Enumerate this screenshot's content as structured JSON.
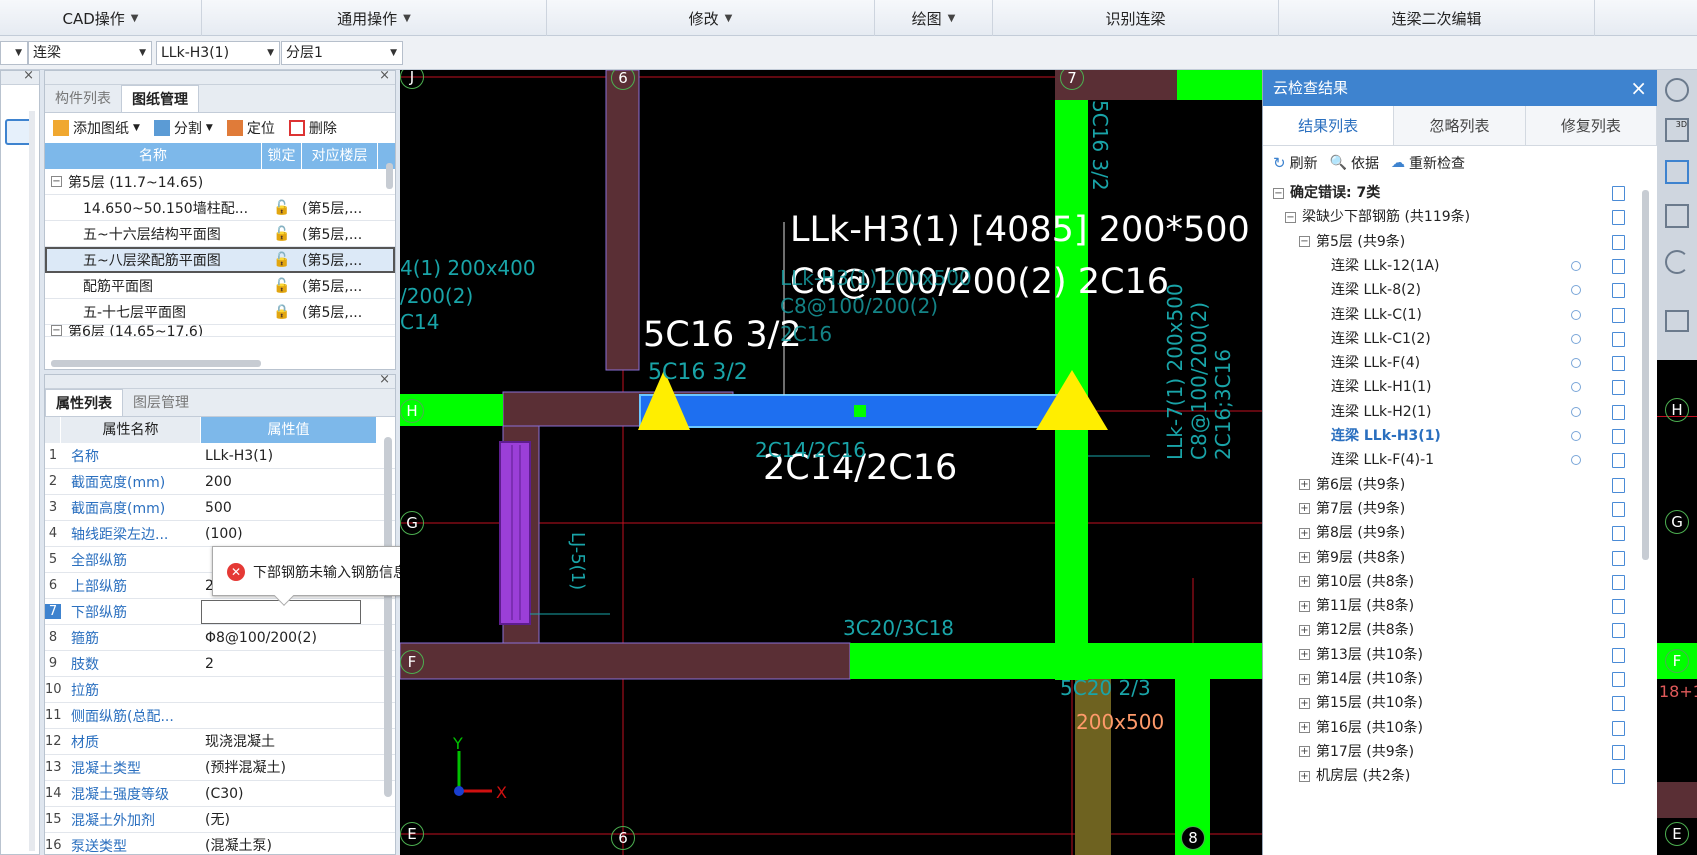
{
  "ribbon": {
    "groups": [
      {
        "label": "CAD操作",
        "dropdown": true
      },
      {
        "label": "通用操作",
        "dropdown": true
      },
      {
        "label": "修改",
        "dropdown": true
      },
      {
        "label": "绘图",
        "dropdown": true
      },
      {
        "label": "识别连梁",
        "dropdown": false
      },
      {
        "label": "连梁二次编辑",
        "dropdown": false
      }
    ]
  },
  "selectors": {
    "type": "连梁",
    "name": "LLk-H3(1)",
    "layer": "分层1"
  },
  "drawing_panel": {
    "tabs": [
      "构件列表",
      "图纸管理"
    ],
    "active_tab": "图纸管理",
    "toolbar": {
      "add": "添加图纸",
      "split": "分割",
      "locate": "定位",
      "delete": "删除"
    },
    "columns": [
      "名称",
      "锁定",
      "对应楼层"
    ],
    "floor_group": "第5层 (11.7~14.65)",
    "rows": [
      {
        "name": "14.650~50.150墙柱配...",
        "floor": "(第5层,..."
      },
      {
        "name": "五~十六层结构平面图",
        "floor": "(第5层,..."
      },
      {
        "name": "五~八层梁配筋平面图",
        "floor": "(第5层,..."
      },
      {
        "name": "配筋平面图",
        "floor": "(第5层,..."
      },
      {
        "name": "五-十七层平面图",
        "floor": "(第5层,..."
      }
    ],
    "next_group": "第6层 (14.65~17.6)"
  },
  "property_panel": {
    "tabs": [
      "属性列表",
      "图层管理"
    ],
    "active_tab": "属性列表",
    "columns": [
      "属性名称",
      "属性值"
    ],
    "rows": [
      {
        "n": "1",
        "name": "名称",
        "value": "LLk-H3(1)"
      },
      {
        "n": "2",
        "name": "截面宽度(mm)",
        "value": "200"
      },
      {
        "n": "3",
        "name": "截面高度(mm)",
        "value": "500"
      },
      {
        "n": "4",
        "name": "轴线距梁左边...",
        "value": "(100)"
      },
      {
        "n": "5",
        "name": "全部纵筋",
        "value": ""
      },
      {
        "n": "6",
        "name": "上部纵筋",
        "value": "2"
      },
      {
        "n": "7",
        "name": "下部纵筋",
        "value": ""
      },
      {
        "n": "8",
        "name": "箍筋",
        "value": "Φ8@100/200(2)"
      },
      {
        "n": "9",
        "name": "肢数",
        "value": "2"
      },
      {
        "n": "10",
        "name": "拉筋",
        "value": ""
      },
      {
        "n": "11",
        "name": "侧面纵筋(总配...",
        "value": ""
      },
      {
        "n": "12",
        "name": "材质",
        "value": "现浇混凝土"
      },
      {
        "n": "13",
        "name": "混凝土类型",
        "value": "(预拌混凝土)"
      },
      {
        "n": "14",
        "name": "混凝土强度等级",
        "value": "(C30)"
      },
      {
        "n": "15",
        "name": "混凝土外加剂",
        "value": "(无)"
      },
      {
        "n": "16",
        "name": "泵送类型",
        "value": "(混凝土泵)"
      }
    ],
    "popup": "下部钢筋未输入钢筋信息"
  },
  "canvas": {
    "axis_labels": {
      "J": "J",
      "H": "H",
      "G": "G",
      "F": "F",
      "E": "E",
      "c6": "6",
      "c7": "7",
      "c8": "8"
    },
    "annotations": {
      "main1": "LLk-H3(1) [4085] 200*500",
      "main2": "C8@100/200(2) 2C16",
      "top_left_bar": "5C16 3/2",
      "small_top": "5C16 3/2",
      "bottom_bar": "2C14/2C16",
      "small_bottom": "2C14/2C16",
      "left1": "4(1) 200x400",
      "left2": "/200(2)",
      "left3": "C14",
      "vert_right": "5C16 3/2",
      "vert_beam": "LLk-7(1) 200x500",
      "vert_beam2": "C8@100/200(2)",
      "vert_beam3": "2C16;3C16",
      "ghost1": "LLk-H3(1) 200x500",
      "ghost2": "C8@100/200(2)",
      "ghost3": "2C16",
      "lj": "LJ-5(1)",
      "bar_f": "3C20/3C18",
      "bar_e1": "5C20 2/3",
      "bar_e2": "200x500",
      "y_axis": "Y",
      "x_axis": "X",
      "edge": "18+1"
    }
  },
  "result_panel": {
    "title": "云检查结果",
    "tabs": [
      "结果列表",
      "忽略列表",
      "修复列表"
    ],
    "active_tab": "结果列表",
    "tools": {
      "refresh": "刷新",
      "basis": "依据",
      "recheck": "重新检查"
    },
    "root": "确定错误: 7类",
    "category": "梁缺少下部钢筋 (共119条)",
    "floor5": "第5层 (共9条)",
    "items": [
      "连梁 LLk-12(1A)",
      "连梁 LLk-8(2)",
      "连梁 LLk-C(1)",
      "连梁 LLk-C1(2)",
      "连梁 LLk-F(4)",
      "连梁 LLk-H1(1)",
      "连梁 LLk-H2(1)",
      "连梁 LLk-H3(1)",
      "连梁 LLk-F(4)-1"
    ],
    "selected_item": "连梁 LLk-H3(1)",
    "other_floors": [
      "第6层 (共9条)",
      "第7层 (共9条)",
      "第8层 (共9条)",
      "第9层 (共8条)",
      "第10层 (共8条)",
      "第11层 (共8条)",
      "第12层 (共8条)",
      "第13层 (共10条)",
      "第14层 (共10条)",
      "第15层 (共10条)",
      "第16层 (共10条)",
      "第17层 (共9条)",
      "机房层 (共2条)"
    ]
  },
  "colors": {
    "accent": "#3e83cf",
    "beam_blue": "#1e6ff0",
    "wall_green": "#00ff00",
    "column_maroon": "#5a2f35",
    "grid_red": "#d0101a",
    "text_cyan": "#19a4a8"
  }
}
